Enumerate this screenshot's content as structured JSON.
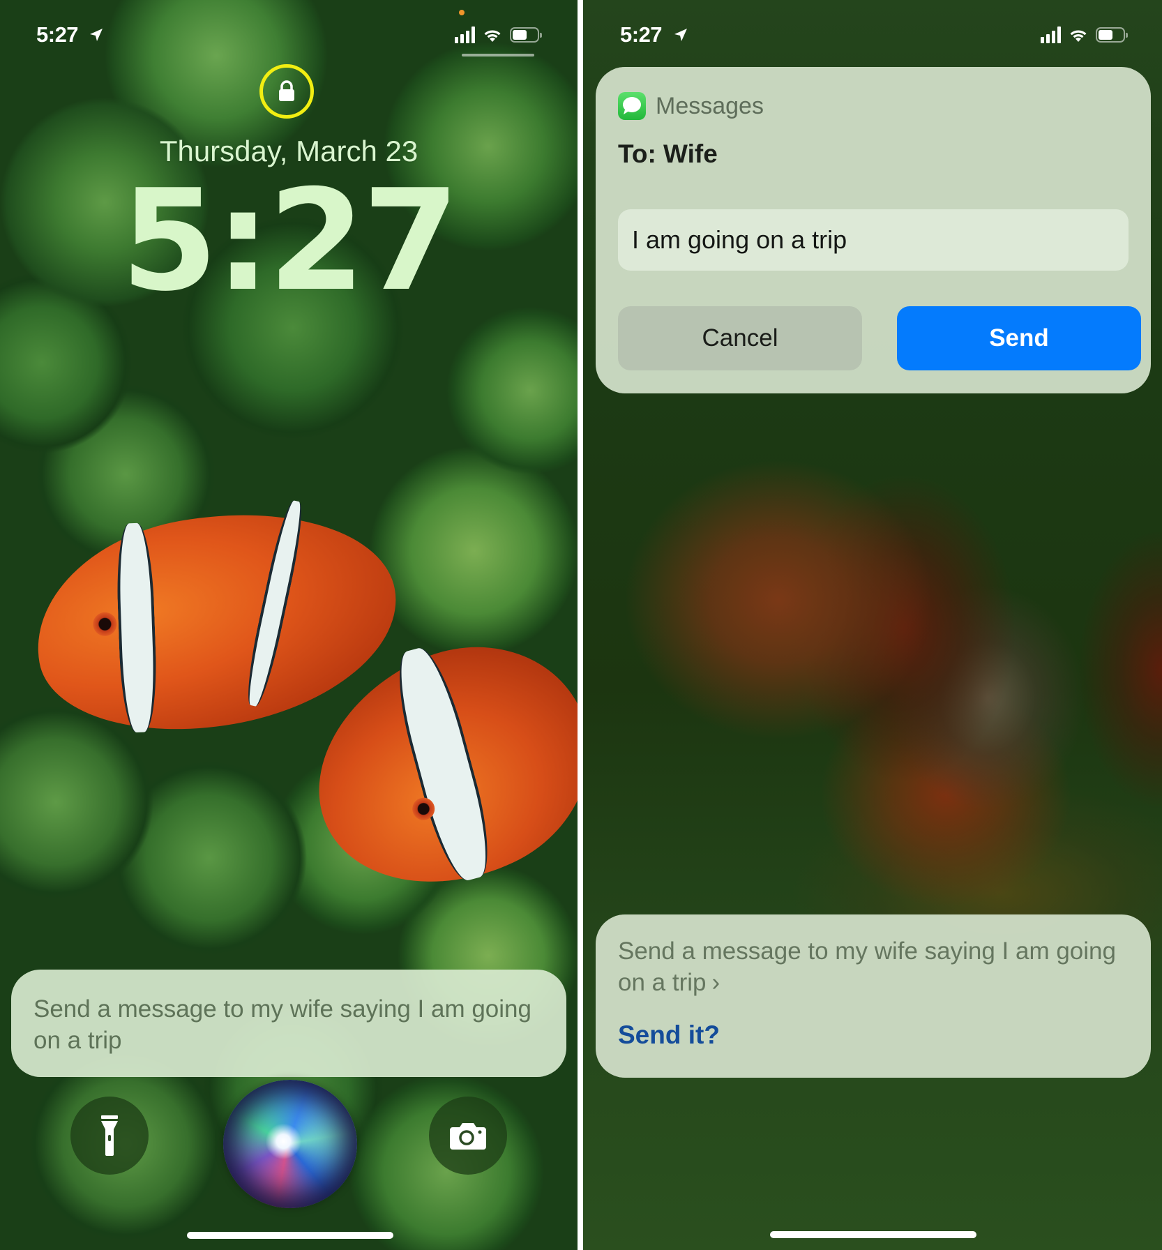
{
  "left_screen": {
    "status_bar": {
      "time": "5:27",
      "location_icon": "location-arrow-icon",
      "signal_icon": "cellular-signal-icon",
      "wifi_icon": "wifi-icon",
      "battery_icon": "battery-icon",
      "battery_level": 0.6,
      "privacy_indicator_color": "#f0952b"
    },
    "lock_icon": "lock-icon",
    "lock_highlight_color": "#f2ee12",
    "date": "Thursday, March 23",
    "clock": "5:27",
    "siri_query": "Send a message to my wife saying I am going on a trip",
    "quick_actions": {
      "flashlight_icon": "flashlight-icon",
      "camera_icon": "camera-icon"
    },
    "siri_orb": "siri-orb"
  },
  "right_screen": {
    "status_bar": {
      "time": "5:27",
      "location_icon": "location-arrow-icon",
      "signal_icon": "cellular-signal-icon",
      "wifi_icon": "wifi-icon",
      "battery_icon": "battery-icon",
      "battery_level": 0.6
    },
    "message_card": {
      "app_name": "Messages",
      "app_icon": "messages-app-icon",
      "recipient": "To: Wife",
      "message_body": "I am going on a trip",
      "cancel_label": "Cancel",
      "send_label": "Send",
      "send_color": "#047bfd"
    },
    "siri_card": {
      "query": "Send a message to my wife saying I am going on a trip",
      "chevron": "›",
      "prompt": "Send it?",
      "prompt_color": "#144c9a"
    },
    "siri_orb": "siri-orb"
  }
}
